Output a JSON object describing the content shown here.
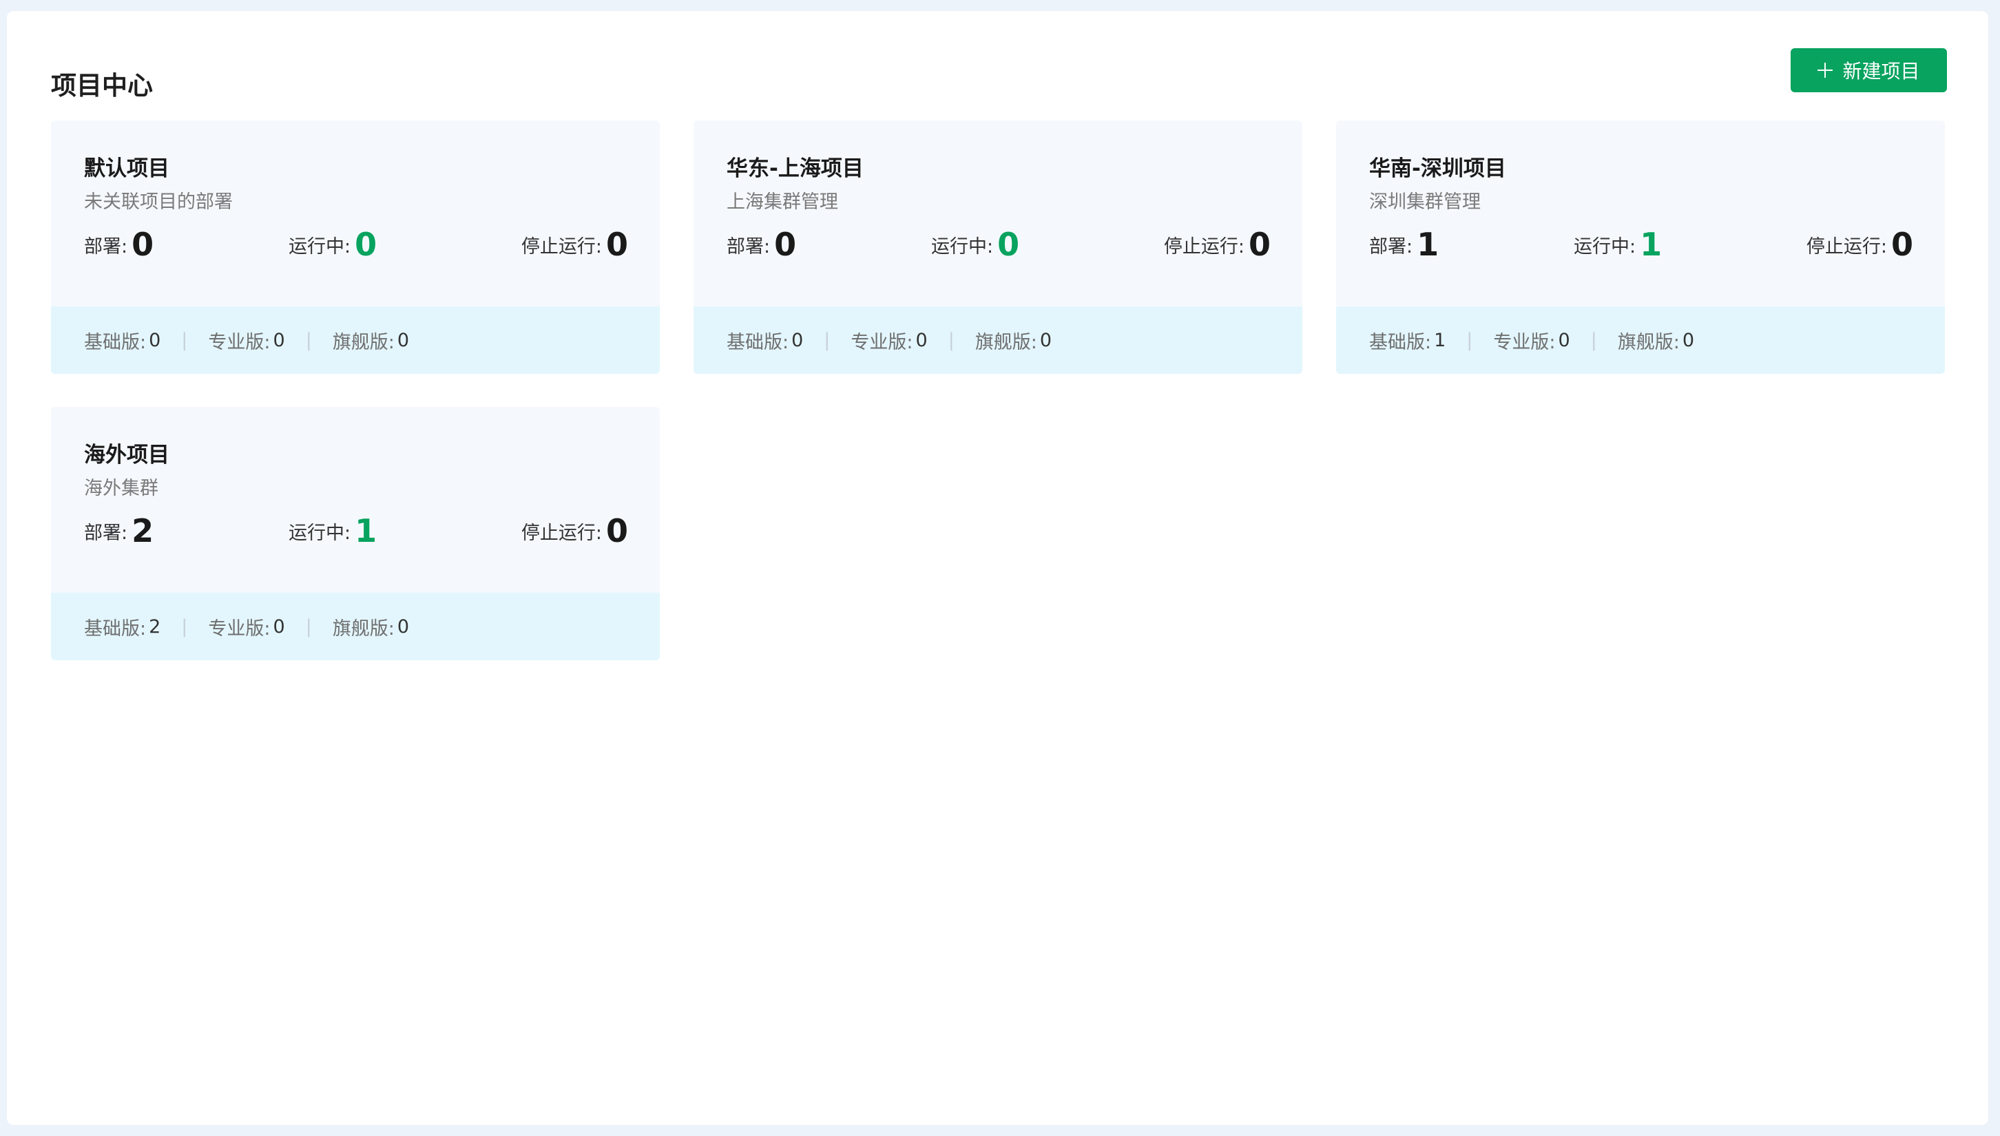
{
  "header": {
    "title": "项目中心",
    "new_button_label": "新建项目"
  },
  "labels": {
    "deploy": "部署:",
    "running": "运行中:",
    "stopped": "停止运行:",
    "basic": "基础版:",
    "pro": "专业版:",
    "flagship": "旗舰版:",
    "separator": "|"
  },
  "colors": {
    "accent": "#07a35f",
    "card_bg": "#f5f9fd",
    "card_footer_bg": "#e3f6fd",
    "page_bg": "#edf3fa"
  },
  "projects": [
    {
      "name": "默认项目",
      "desc": "未关联项目的部署",
      "deploy": "0",
      "running": "0",
      "stopped": "0",
      "basic": "0",
      "pro": "0",
      "flagship": "0"
    },
    {
      "name": "华东-上海项目",
      "desc": "上海集群管理",
      "deploy": "0",
      "running": "0",
      "stopped": "0",
      "basic": "0",
      "pro": "0",
      "flagship": "0"
    },
    {
      "name": "华南-深圳项目",
      "desc": "深圳集群管理",
      "deploy": "1",
      "running": "1",
      "stopped": "0",
      "basic": "1",
      "pro": "0",
      "flagship": "0"
    },
    {
      "name": "海外项目",
      "desc": "海外集群",
      "deploy": "2",
      "running": "1",
      "stopped": "0",
      "basic": "2",
      "pro": "0",
      "flagship": "0"
    }
  ]
}
